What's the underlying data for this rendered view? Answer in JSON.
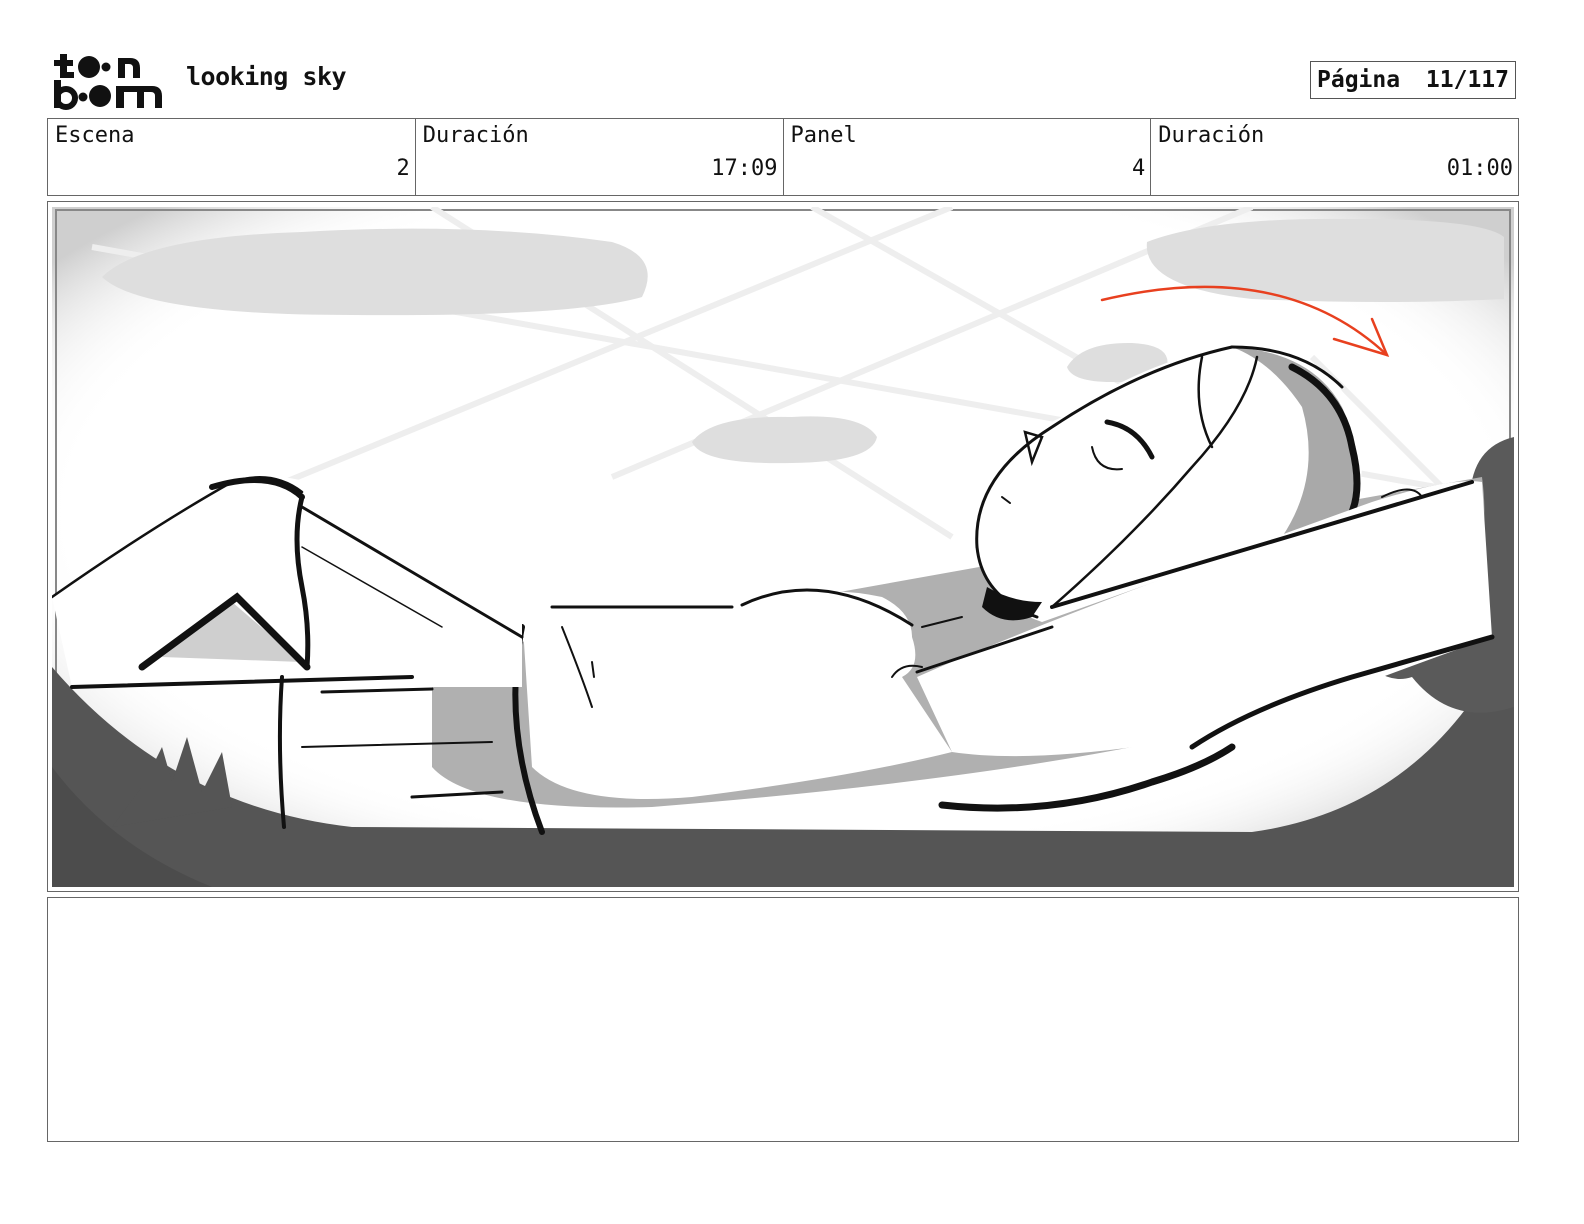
{
  "header": {
    "project_title": "looking sky",
    "page_label": "Página",
    "page_number": "11/117"
  },
  "info": {
    "scene_label": "Escena",
    "scene_value": "2",
    "scene_duration_label": "Duración",
    "scene_duration_value": "17:09",
    "panel_label": "Panel",
    "panel_value": "4",
    "panel_duration_label": "Duración",
    "panel_duration_value": "01:00"
  },
  "colors": {
    "accent_arrow": "#e8401f",
    "shadow_gray": "#a9a9a9",
    "vignette_dark": "#555555"
  },
  "icons": {
    "logo": "toonboom-logo"
  }
}
